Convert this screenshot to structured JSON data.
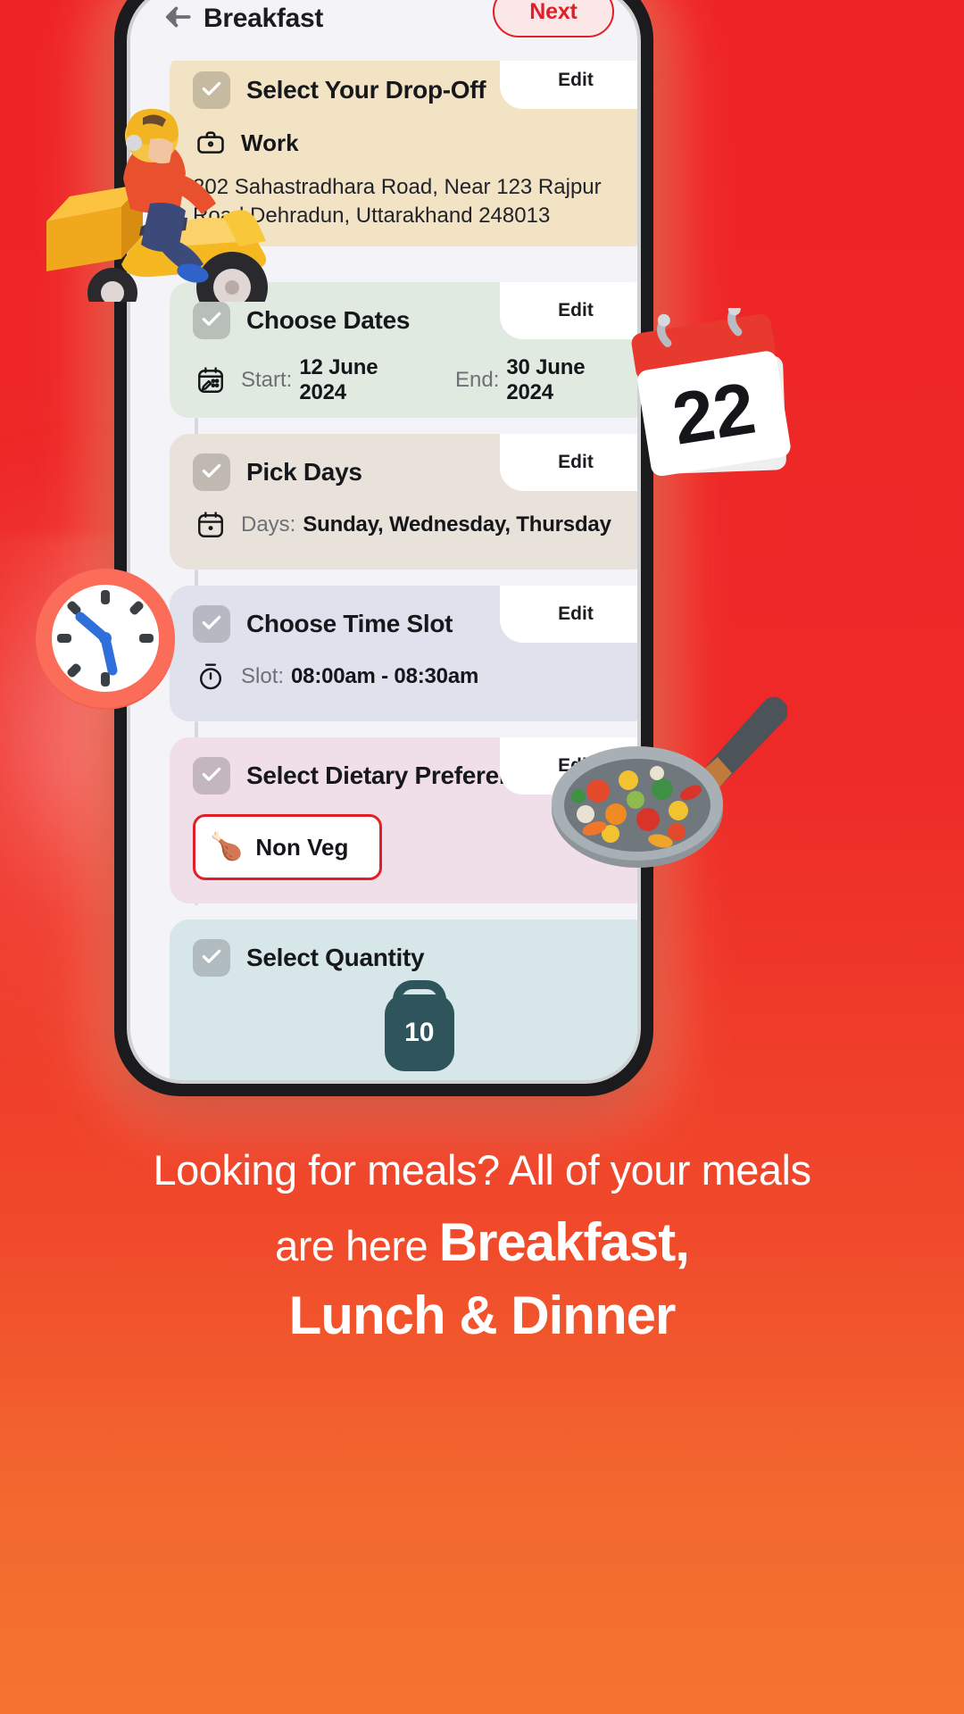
{
  "header": {
    "back_icon": "arrow-left-icon",
    "title": "Breakfast",
    "next_label": "Next"
  },
  "brand": {
    "red": "#e01f26",
    "bg_top": "#ee2326",
    "bg_bottom": "#f4742f",
    "teal": "#2d555b"
  },
  "steps": [
    {
      "id": "drop-off",
      "title": "Select Your Drop-Off",
      "edit_label": "Edit",
      "icon": "briefcase-icon",
      "place": "Work",
      "address": "202 Sahastradhara Road, Near 123 Rajpur Road Dehradun, Uttarakhand 248013",
      "checked": true,
      "color": "#f2e3c5"
    },
    {
      "id": "dates",
      "title": "Choose Dates",
      "edit_label": "Edit",
      "icon": "calendar-edit-icon",
      "start_label": "Start:",
      "start_value": "12 June 2024",
      "end_label": "End:",
      "end_value": "30 June 2024",
      "checked": true,
      "color": "#e1eae1"
    },
    {
      "id": "days",
      "title": "Pick Days",
      "edit_label": "Edit",
      "icon": "calendar-icon",
      "days_label": "Days:",
      "days_value": "Sunday, Wednesday, Thursday",
      "checked": true,
      "color": "#e9e2da"
    },
    {
      "id": "time-slot",
      "title": "Choose Time Slot",
      "edit_label": "Edit",
      "icon": "stopwatch-icon",
      "slot_label": "Slot:",
      "slot_value": "08:00am - 08:30am",
      "checked": true,
      "color": "#dfe2ec"
    },
    {
      "id": "dietary",
      "title": "Select Dietary Preference",
      "edit_label": "Edit",
      "chip_emoji": "🍗",
      "chip_label": "Non Veg",
      "checked": true,
      "color": "#f0dfe9"
    },
    {
      "id": "quantity",
      "title": "Select Quantity",
      "value": "10",
      "slider_percent": 52,
      "checked": true,
      "color": "#d7e6e9"
    }
  ],
  "decor": {
    "scooter": "delivery-scooter-illustration",
    "calendar": "calendar-22-illustration",
    "clock": "alarm-clock-illustration",
    "pan": "frying-pan-vegetables-illustration"
  },
  "headline": {
    "line1": "Looking for meals? All of your meals",
    "line2_light": "are here",
    "line2_strong": "Breakfast,",
    "line3": "Lunch & Dinner"
  }
}
